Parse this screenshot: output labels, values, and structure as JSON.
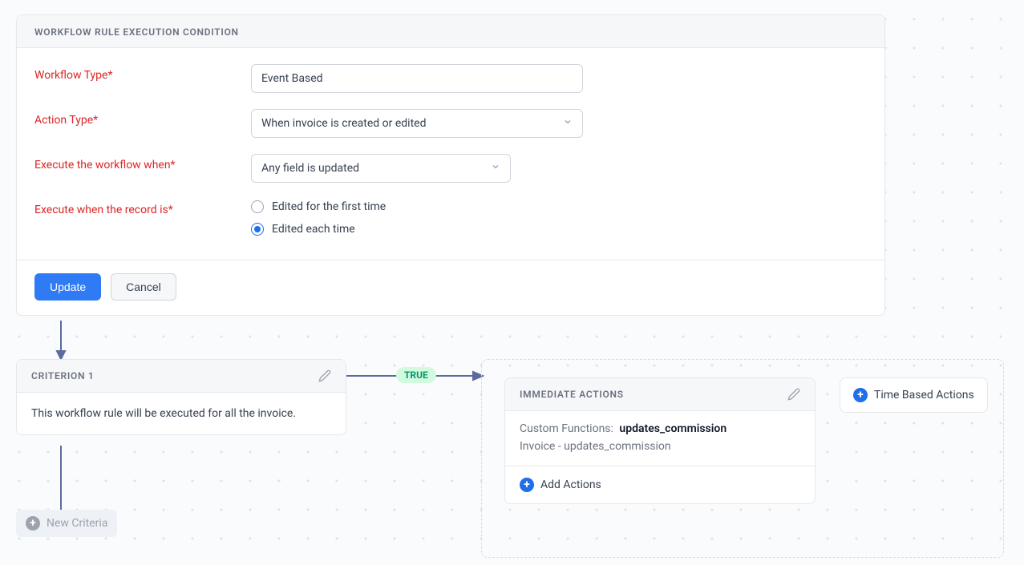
{
  "execution": {
    "title": "WORKFLOW RULE EXECUTION CONDITION",
    "workflow_type_label": "Workflow Type*",
    "workflow_type_value": "Event Based",
    "action_type_label": "Action Type*",
    "action_type_value": "When invoice is created or edited",
    "execute_when_label": "Execute the workflow when*",
    "execute_when_value": "Any field is updated",
    "record_is_label": "Execute when the record is*",
    "record_opt_first": "Edited for the first time",
    "record_opt_each": "Edited each time",
    "update_btn": "Update",
    "cancel_btn": "Cancel"
  },
  "criterion": {
    "title": "CRITERION 1",
    "body": "This workflow rule will be executed for all the invoice."
  },
  "connector": {
    "true_label": "TRUE"
  },
  "actions": {
    "title": "IMMEDIATE ACTIONS",
    "fn_label": "Custom Functions:",
    "fn_name": "updates_commission",
    "fn_detail": "Invoice - updates_commission",
    "add_actions": "Add Actions",
    "time_based": "Time Based Actions"
  },
  "new_criteria": {
    "label": "New Criteria"
  }
}
